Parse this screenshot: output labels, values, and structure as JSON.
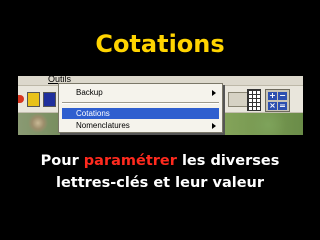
{
  "slide": {
    "title": "Cotations",
    "caption": {
      "line1_before": "Pour ",
      "line1_accent": "paramétrer",
      "line1_after": " les diverses",
      "line2": "lettres-clés et leur valeur"
    }
  },
  "screenshot": {
    "menubar": {
      "outils_label": "Outils"
    },
    "menu": {
      "items": [
        {
          "label": "Backup",
          "has_submenu": true
        },
        {
          "label": "Cotations",
          "has_submenu": false,
          "selected": true
        },
        {
          "label": "Nomenclatures",
          "has_submenu": true
        }
      ]
    },
    "calculator_keys": [
      "+",
      "−",
      "×",
      "="
    ]
  },
  "colors": {
    "title": "#ffd400",
    "accent": "#ff2a1e",
    "caption": "#ffffff",
    "background": "#000000",
    "menu_highlight": "#2f5fcf"
  }
}
